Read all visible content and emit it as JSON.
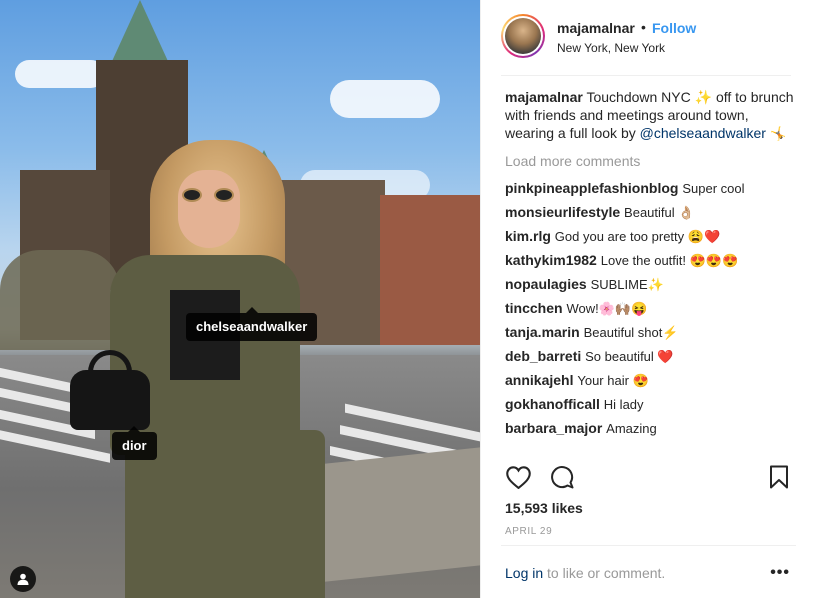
{
  "photo": {
    "tags": [
      {
        "label": "chelseaandwalker"
      },
      {
        "label": "dior"
      }
    ]
  },
  "header": {
    "username": "majamalnar",
    "separator": "•",
    "follow_label": "Follow",
    "location": "New York, New York"
  },
  "caption": {
    "username": "majamalnar",
    "text_before": "Touchdown NYC ✨ off to brunch with friends and meetings around town, wearing a full look by ",
    "mention": "@chelseaandwalker",
    "text_after": " 🤸"
  },
  "load_more_label": "Load more comments",
  "comments": [
    {
      "user": "pinkpineapplefashionblog",
      "text": "Super cool"
    },
    {
      "user": "monsieurlifestyle",
      "text": "Beautiful 👌🏼"
    },
    {
      "user": "kim.rlg",
      "text": "God you are too pretty 😩❤️"
    },
    {
      "user": "kathykim1982",
      "text": "Love the outfit! 😍😍😍"
    },
    {
      "user": "nopaulagies",
      "text": "SUBLIME✨"
    },
    {
      "user": "tincchen",
      "text": "Wow!🌸🙌🏽😝"
    },
    {
      "user": "tanja.marin",
      "text": "Beautiful shot⚡"
    },
    {
      "user": "deb_barreti",
      "text": "So beautiful ❤️"
    },
    {
      "user": "annikajehl",
      "text": "Your hair 😍"
    },
    {
      "user": "gokhanofficall",
      "text": "Hi lady"
    },
    {
      "user": "barbara_major",
      "text": "Amazing"
    }
  ],
  "icons": {
    "like": "heart-outline-icon",
    "comment": "speech-bubble-icon",
    "save": "bookmark-icon",
    "user_tags": "person-icon",
    "more": "ellipsis-icon"
  },
  "likes_label": "15,593 likes",
  "date_label": "APRIL 29",
  "footer": {
    "login_link": "Log in",
    "login_rest": " to like or comment.",
    "more_label": "•••"
  },
  "colors": {
    "link": "#3897f0",
    "mention": "#003569",
    "muted": "#999999",
    "text": "#262626"
  }
}
